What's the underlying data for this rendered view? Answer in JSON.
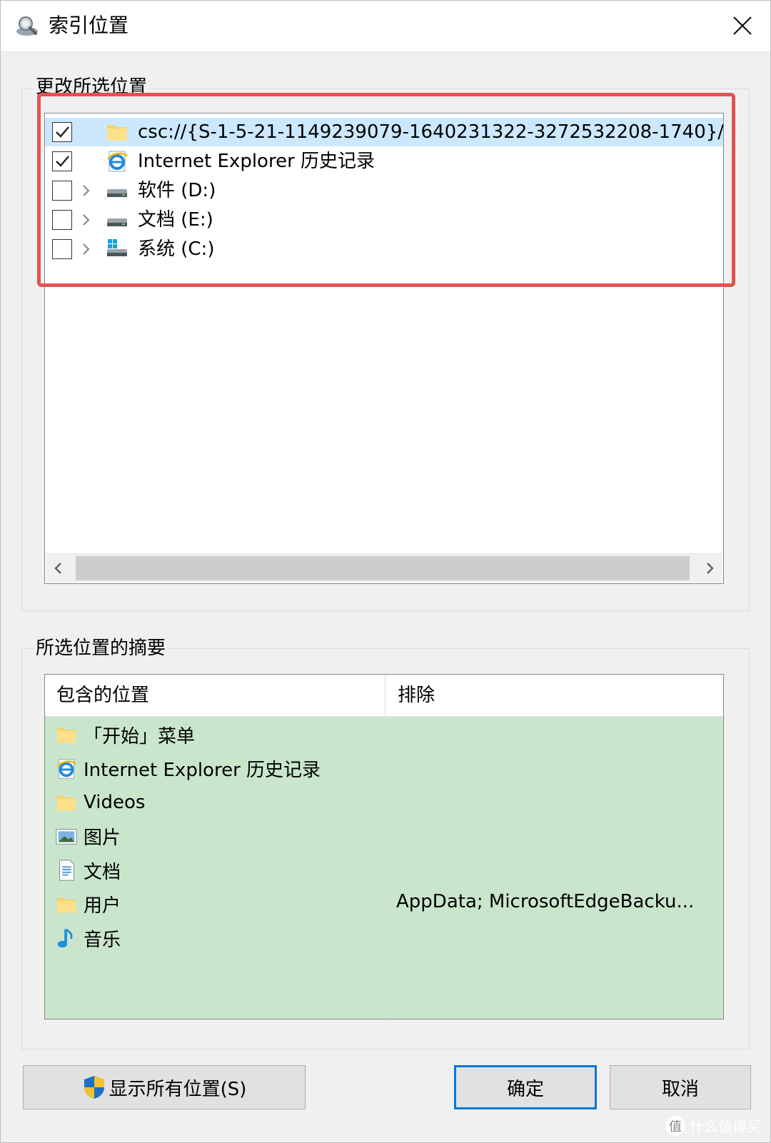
{
  "window": {
    "title": "索引位置",
    "close_glyph": "✕"
  },
  "change_group": {
    "label": "更改所选位置",
    "items": [
      {
        "label": "csc://{S-1-5-21-1149239079-1640231322-3272532208-1740}/",
        "checked": true,
        "expandable": false,
        "icon": "folder-icon",
        "selected": true
      },
      {
        "label": "Internet Explorer 历史记录",
        "checked": true,
        "expandable": false,
        "icon": "internet-explorer-icon",
        "selected": false
      },
      {
        "label": "软件 (D:)",
        "checked": false,
        "expandable": true,
        "icon": "drive-icon",
        "selected": false
      },
      {
        "label": "文档 (E:)",
        "checked": false,
        "expandable": true,
        "icon": "drive-icon",
        "selected": false
      },
      {
        "label": "系统 (C:)",
        "checked": false,
        "expandable": true,
        "icon": "system-drive-icon",
        "selected": false
      }
    ],
    "scroll_left": "‹",
    "scroll_right": "›"
  },
  "summary_group": {
    "label": "所选位置的摘要",
    "col_included": "包含的位置",
    "col_excluded": "排除",
    "included": [
      {
        "label": "「开始」菜单",
        "icon": "folder-icon"
      },
      {
        "label": "Internet Explorer 历史记录",
        "icon": "internet-explorer-icon"
      },
      {
        "label": "Videos",
        "icon": "folder-icon"
      },
      {
        "label": "图片",
        "icon": "pictures-icon"
      },
      {
        "label": "文档",
        "icon": "document-icon"
      },
      {
        "label": "用户",
        "icon": "folder-icon"
      },
      {
        "label": "音乐",
        "icon": "music-icon"
      }
    ],
    "excluded_for_users": "AppData; MicrosoftEdgeBacku..."
  },
  "buttons": {
    "show_all": "显示所有位置(S)",
    "ok": "确定",
    "cancel": "取消"
  },
  "watermark": {
    "logo": "值",
    "text": "什么值得买"
  },
  "colors": {
    "highlight_box": "#e35252",
    "summary_bg": "#c9e6cc",
    "selected_row": "#cce8ff",
    "primary_border": "#0078d7"
  }
}
